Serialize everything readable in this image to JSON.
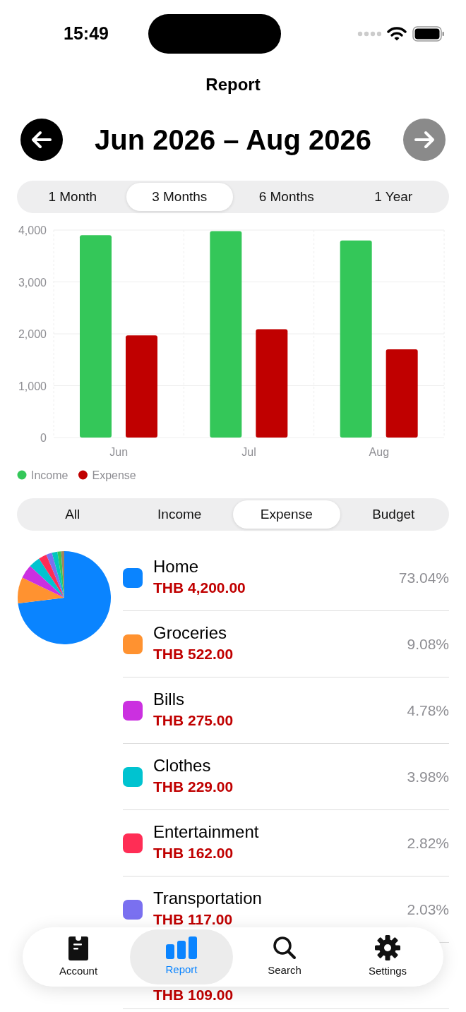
{
  "status_bar": {
    "time": "15:49"
  },
  "title": "Report",
  "period": {
    "label": "Jun 2026 – Aug 2026",
    "prev_enabled": true,
    "next_enabled": false
  },
  "range_tabs": [
    {
      "label": "1 Month",
      "selected": false
    },
    {
      "label": "3 Months",
      "selected": true
    },
    {
      "label": "6 Months",
      "selected": false
    },
    {
      "label": "1 Year",
      "selected": false
    }
  ],
  "chart": {
    "chart_data": {
      "type": "bar",
      "categories": [
        "Jun",
        "Jul",
        "Aug"
      ],
      "series": [
        {
          "name": "Income",
          "color": "#34c759",
          "values": [
            3900,
            3980,
            3800
          ]
        },
        {
          "name": "Expense",
          "color": "#c00000",
          "values": [
            1970,
            2090,
            1700
          ]
        }
      ],
      "grid": true,
      "legend": true,
      "ylim": [
        0,
        4000
      ],
      "yticks": [
        {
          "value": 0,
          "label": "0"
        },
        {
          "value": 1000,
          "label": "1,000"
        },
        {
          "value": 2000,
          "label": "2,000"
        },
        {
          "value": 3000,
          "label": "3,000"
        },
        {
          "value": 4000,
          "label": "4,000"
        }
      ]
    }
  },
  "type_tabs": [
    {
      "label": "All",
      "selected": false
    },
    {
      "label": "Income",
      "selected": false
    },
    {
      "label": "Expense",
      "selected": true
    },
    {
      "label": "Budget",
      "selected": false
    }
  ],
  "categories": [
    {
      "name": "Home",
      "amount": "THB 4,200.00",
      "percent": "73.04%",
      "color": "#0a84ff"
    },
    {
      "name": "Groceries",
      "amount": "THB 522.00",
      "percent": "9.08%",
      "color": "#ff9230"
    },
    {
      "name": "Bills",
      "amount": "THB 275.00",
      "percent": "4.78%",
      "color": "#cb30e0"
    },
    {
      "name": "Clothes",
      "amount": "THB 229.00",
      "percent": "3.98%",
      "color": "#00c3d0"
    },
    {
      "name": "Entertainment",
      "amount": "THB 162.00",
      "percent": "2.82%",
      "color": "#ff2d55"
    },
    {
      "name": "Transportation",
      "amount": "THB 117.00",
      "percent": "2.03%",
      "color": "#7a70f0"
    },
    {
      "amount": "THB 109.00"
    }
  ],
  "tab_bar": [
    {
      "label": "Account",
      "kind": "account",
      "selected": false
    },
    {
      "label": "Report",
      "kind": "report",
      "selected": true
    },
    {
      "label": "Search",
      "kind": "search",
      "selected": false
    },
    {
      "label": "Settings",
      "kind": "settings",
      "selected": false
    }
  ]
}
